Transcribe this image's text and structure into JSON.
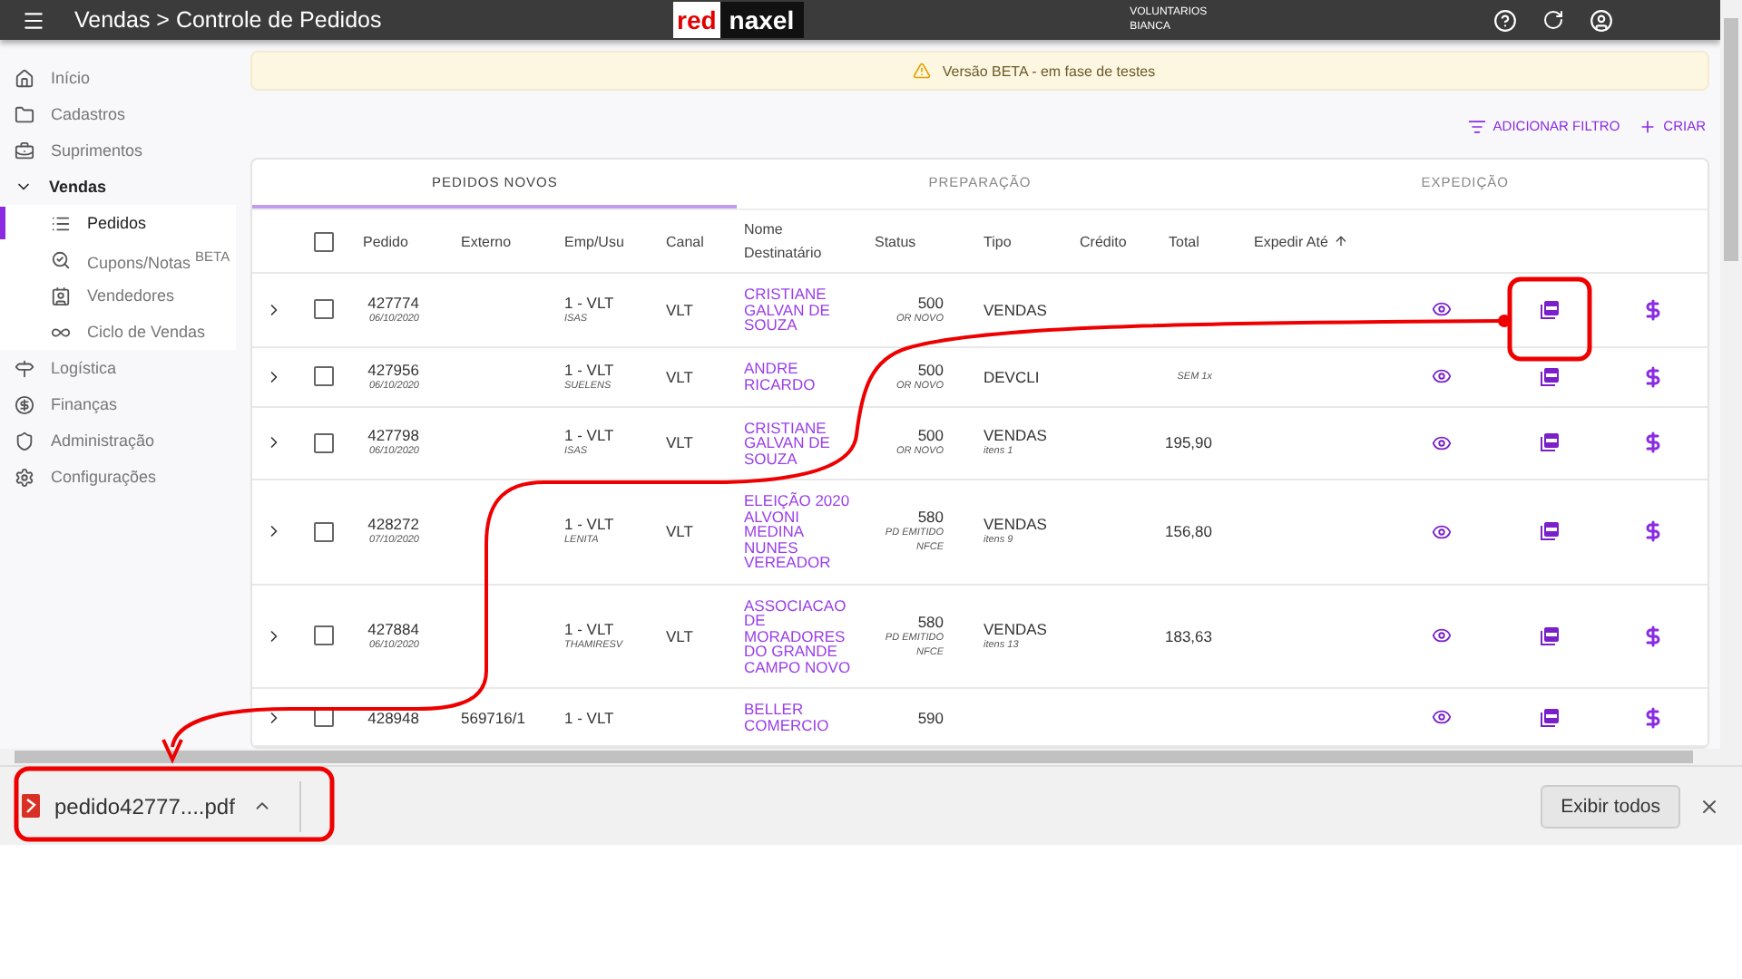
{
  "top_bar": {
    "title": "Vendas > Controle de Pedidos",
    "logo": [
      "red",
      "naxel"
    ],
    "user": [
      "VOLUNTARIOS",
      "BIANCA"
    ]
  },
  "sidebar": {
    "items": [
      {
        "label": "Início",
        "selected": false
      },
      {
        "label": "Cadastros",
        "selected": false
      },
      {
        "label": "Suprimentos",
        "selected": false
      },
      {
        "label": "Vendas",
        "selected": false,
        "expanded": true,
        "children": [
          {
            "label": "Pedidos",
            "selected": true
          },
          {
            "label": "Cupons/Notas $^{BETA}$",
            "selected": false
          },
          {
            "label": "Vendedores",
            "selected": false
          },
          {
            "label": "Ciclo de Vendas",
            "selected": false
          }
        ]
      },
      {
        "label": "Logística",
        "selected": false
      },
      {
        "label": "Finanças",
        "selected": false
      },
      {
        "label": "Administração",
        "selected": false
      },
      {
        "label": "Configurações",
        "selected": false
      }
    ]
  },
  "banner": "Versão BETA - em fase de testes",
  "actions": [
    "ADICIONAR FILTRO",
    "CRIAR"
  ],
  "tabs": [
    {
      "label": "PEDIDOS NOVOS",
      "selected": true
    },
    {
      "label": "PREPARAÇÃO",
      "selected": false
    },
    {
      "label": "EXPEDIÇÃO",
      "selected": false
    }
  ],
  "table": {
    "select_all_checked": false,
    "columns": [
      "Pedido",
      "Externo",
      "Emp/Usu",
      "Canal",
      "Nome Destinatário",
      "Status",
      "Tipo",
      "Crédito",
      "Total",
      "Expedir Até"
    ],
    "rows": [
      {
        "checked": false,
        "expanded": false,
        "pedido": "427774",
        "date": "06/10/2020",
        "emp": "1 - VLT",
        "usu": "ISAS",
        "canal": "VLT",
        "nome": "CRISTIANE GALVAN DE SOUZA",
        "status": "500",
        "status_notes": [
          "OR NOVO"
        ],
        "tipo": "VENDAS"
      },
      {
        "checked": false,
        "expanded": false,
        "pedido": "427956",
        "date": "06/10/2020",
        "emp": "1 - VLT",
        "usu": "SUELENS",
        "canal": "VLT",
        "nome": "ANDRE RICARDO",
        "status": "500",
        "status_notes": [
          "OR NOVO"
        ],
        "tipo": "DEVCLI",
        "total_note": "SEM 1x"
      },
      {
        "checked": false,
        "expanded": false,
        "pedido": "427798",
        "date": "06/10/2020",
        "emp": "1 - VLT",
        "usu": "ISAS",
        "canal": "VLT",
        "nome": "CRISTIANE GALVAN DE SOUZA",
        "status": "500",
        "status_notes": [
          "OR NOVO"
        ],
        "tipo": "VENDAS",
        "itens": "itens 1",
        "total": "195,90"
      },
      {
        "checked": false,
        "expanded": false,
        "pedido": "428272",
        "date": "07/10/2020",
        "emp": "1 - VLT",
        "usu": "LENITA",
        "canal": "VLT",
        "nome": "ELEIÇÃO 2020 ALVONI MEDINA NUNES VEREADOR",
        "status": "580",
        "status_notes": [
          "PD EMITIDO",
          "NFCE"
        ],
        "tipo": "VENDAS",
        "itens": "itens 9",
        "total": "156,80"
      },
      {
        "checked": false,
        "expanded": false,
        "pedido": "427884",
        "date": "06/10/2020",
        "emp": "1 - VLT",
        "usu": "THAMIRESV",
        "canal": "VLT",
        "nome": "ASSOCIACAO DE MORADORES DO GRANDE CAMPO NOVO",
        "status": "580",
        "status_notes": [
          "PD EMITIDO",
          "NFCE"
        ],
        "tipo": "VENDAS",
        "itens": "itens 13",
        "total": "183,63"
      },
      {
        "checked": false,
        "expanded": false,
        "pedido": "428948",
        "externo": "569716/1",
        "emp": "1 - VLT",
        "nome": "BELLER COMERCIO",
        "status": "590"
      }
    ]
  },
  "download_bar": {
    "file": "pedido42777....pdf",
    "button": "Exibir todos"
  }
}
